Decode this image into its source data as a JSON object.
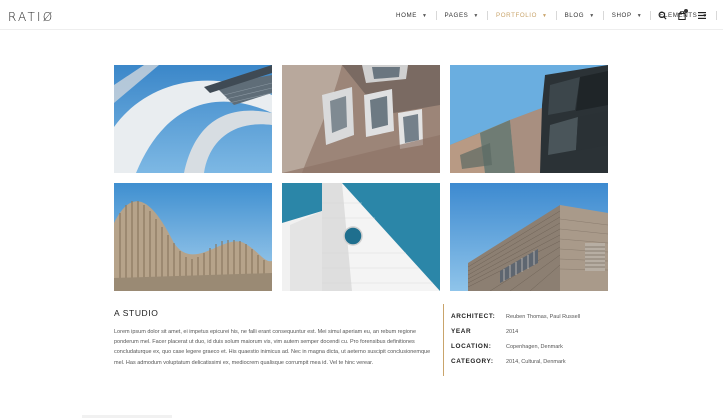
{
  "brand": {
    "logo": "RATIØ"
  },
  "nav": {
    "items": [
      {
        "label": "HOME",
        "active": false
      },
      {
        "label": "PAGES",
        "active": false
      },
      {
        "label": "PORTFOLIO",
        "active": true
      },
      {
        "label": "BLOG",
        "active": false
      },
      {
        "label": "SHOP",
        "active": false
      },
      {
        "label": "ELEMENTS",
        "active": false
      }
    ],
    "icons": [
      "search-icon",
      "cart-icon",
      "menu-icon"
    ]
  },
  "gallery": {
    "images": [
      {
        "name": "curved-white-structure"
      },
      {
        "name": "copper-facade-windows"
      },
      {
        "name": "geometric-tiled-building"
      },
      {
        "name": "wave-ribbed-roof"
      },
      {
        "name": "white-angular-wall-round-window"
      },
      {
        "name": "brick-corner-building"
      }
    ]
  },
  "project": {
    "title": "A STUDIO",
    "description": "Lorem ipsum dolor sit amet, ei impetus epicurei his, ne falli erant consequuntur est. Mei simul aperiam eu, an rebum regione ponderum mel. Facer placerat ut duo, id duis solum maiorum vis, vim autem semper docendi cu. Pro forensibus definitiones concludaturque ex, quo case legere graeco et. His quaestio inimicus ad. Nec in magna dicta, ut aeterno suscipit conclusionemque mel. Has admodum voluptatum delicatissimi ex, mediocrem qualisque corrumpit mea id. Vel te hinc verear.",
    "meta": [
      {
        "label": "ARCHITECT:",
        "value": "Reuben Thomas, Paul Russell"
      },
      {
        "label": "YEAR",
        "value": "2014"
      },
      {
        "label": "LOCATION:",
        "value": "Copenhagen, Denmark"
      },
      {
        "label": "CATEGORY:",
        "value": "2014, Cultural, Denmark"
      }
    ]
  },
  "colors": {
    "accent": "#c9a46b",
    "sky": "#4f9fd6"
  }
}
